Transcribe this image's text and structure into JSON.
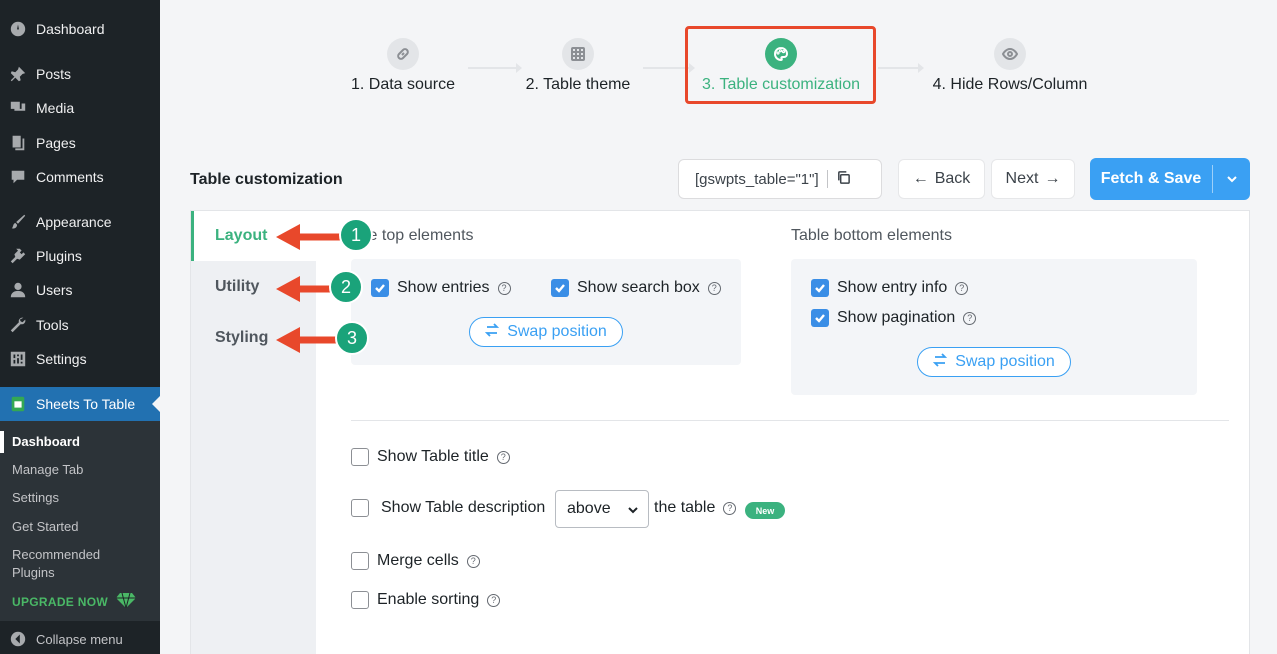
{
  "sidebar": {
    "items": [
      {
        "label": "Dashboard",
        "icon": "dashboard-icon"
      },
      {
        "label": "Posts",
        "icon": "pin-icon"
      },
      {
        "label": "Media",
        "icon": "media-icon"
      },
      {
        "label": "Pages",
        "icon": "pages-icon"
      },
      {
        "label": "Comments",
        "icon": "comment-icon"
      },
      {
        "label": "Appearance",
        "icon": "brush-icon"
      },
      {
        "label": "Plugins",
        "icon": "plug-icon"
      },
      {
        "label": "Users",
        "icon": "user-icon"
      },
      {
        "label": "Tools",
        "icon": "wrench-icon"
      },
      {
        "label": "Settings",
        "icon": "settings-icon"
      },
      {
        "label": "Sheets To Table",
        "icon": "sheets-icon"
      }
    ],
    "submenu": [
      "Dashboard",
      "Manage Tab",
      "Settings",
      "Get Started",
      "Recommended",
      "Plugins"
    ],
    "upgrade": "UPGRADE NOW",
    "collapse": "Collapse menu"
  },
  "steps": [
    {
      "label": "1. Data source",
      "icon": "link-icon"
    },
    {
      "label": "2. Table theme",
      "icon": "grid-icon"
    },
    {
      "label": "3. Table customization",
      "icon": "palette-icon"
    },
    {
      "label": "4. Hide Rows/Column",
      "icon": "eye-icon"
    }
  ],
  "toolbar": {
    "title": "Table customization",
    "shortcode": "[gswpts_table=\"1\"]",
    "back": "Back",
    "next": "Next",
    "fetch_save": "Fetch & Save"
  },
  "tabs": [
    "Layout",
    "Utility",
    "Styling"
  ],
  "layout": {
    "top_label": "le top elements",
    "bottom_label": "Table bottom elements",
    "top_checks": [
      "Show entries",
      "Show search box"
    ],
    "bottom_checks": [
      "Show entry info",
      "Show pagination"
    ],
    "swap": "Swap position",
    "options": {
      "show_title": "Show Table title",
      "show_desc": "Show Table description",
      "desc_position": "above",
      "desc_suffix": "the table",
      "new_badge": "New",
      "merge": "Merge cells",
      "sorting": "Enable sorting"
    }
  },
  "annotations": [
    "1",
    "2",
    "3"
  ],
  "colors": {
    "accent": "#3bb27f",
    "primary": "#3aa0f3",
    "annotation": "#e8482b",
    "badge": "#1aa37a"
  }
}
